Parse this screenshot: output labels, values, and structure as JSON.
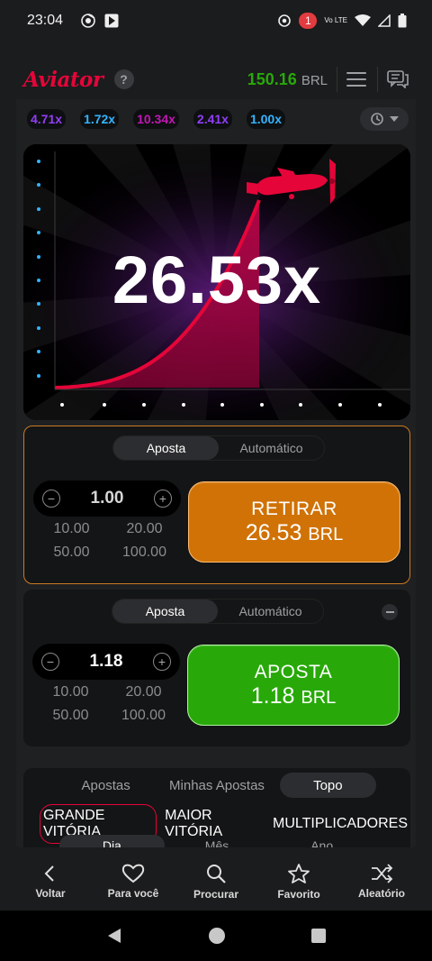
{
  "status_bar": {
    "time": "23:04",
    "notification_count": "1",
    "network": "Vo LTE"
  },
  "header": {
    "logo": "Aviator",
    "help": "?",
    "balance": "150.16",
    "currency": "BRL"
  },
  "history": {
    "multipliers": [
      {
        "value": "4.71x",
        "color": "#913ef8"
      },
      {
        "value": "1.72x",
        "color": "#34b4ff"
      },
      {
        "value": "10.34x",
        "color": "#c017b4"
      },
      {
        "value": "2.41x",
        "color": "#913ef8"
      },
      {
        "value": "1.00x",
        "color": "#34b4ff"
      }
    ]
  },
  "game": {
    "current_multiplier": "26.53x"
  },
  "bet_panel_1": {
    "tab_bet": "Aposta",
    "tab_auto": "Automático",
    "stake": "1.00",
    "quick": [
      "10.00",
      "20.00",
      "50.00",
      "100.00"
    ],
    "button_line1": "RETIRAR",
    "button_amount": "26.53",
    "button_currency": "BRL"
  },
  "bet_panel_2": {
    "tab_bet": "Aposta",
    "tab_auto": "Automático",
    "stake": "1.18",
    "quick": [
      "10.00",
      "20.00",
      "50.00",
      "100.00"
    ],
    "button_line1": "APOSTA",
    "button_amount": "1.18",
    "button_currency": "BRL"
  },
  "bets_list": {
    "tabs": [
      "Apostas",
      "Minhas Apostas",
      "Topo"
    ],
    "categories": [
      "GRANDE VITÓRIA",
      "MAIOR VITÓRIA",
      "MULTIPLICADORES"
    ],
    "periods": [
      "Dia",
      "Mês",
      "Ano"
    ]
  },
  "bottom_nav": [
    "Voltar",
    "Para você",
    "Procurar",
    "Favorito",
    "Aleatório"
  ],
  "colors": {
    "brand": "#e50539",
    "balance": "#28a909",
    "cashout": "#d07206",
    "bet": "#28a909"
  }
}
